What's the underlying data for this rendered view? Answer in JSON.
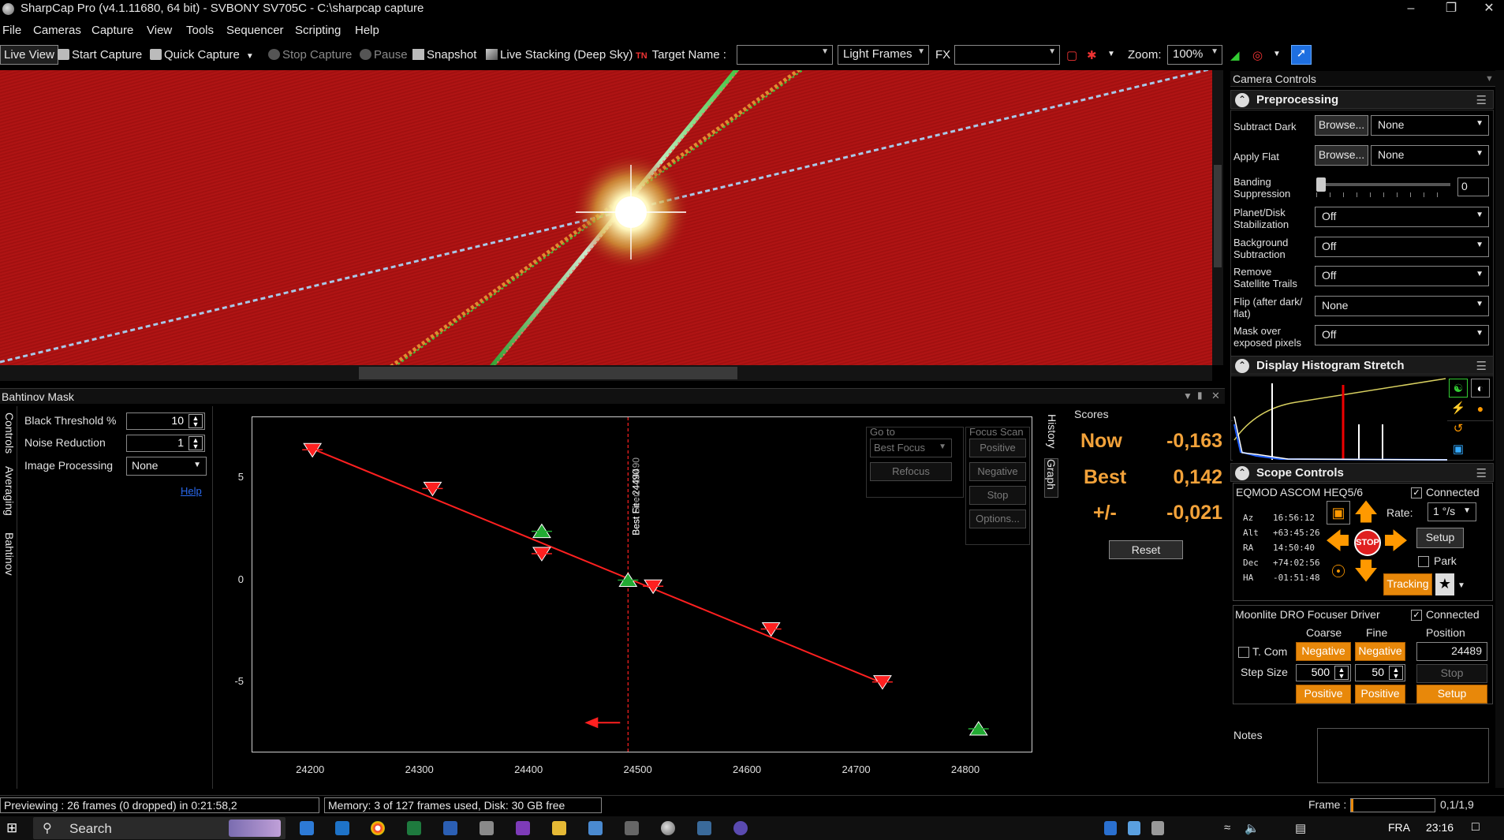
{
  "window": {
    "title": "SharpCap Pro (v4.1.11680, 64 bit) - SVBONY SV705C - C:\\sharpcap capture"
  },
  "menu": [
    "File",
    "Cameras",
    "Capture",
    "View",
    "Tools",
    "Sequencer",
    "Scripting",
    "Help"
  ],
  "toolbar": {
    "live_view": "Live View",
    "start_capture": "Start Capture",
    "quick_capture": "Quick Capture",
    "stop_capture": "Stop Capture",
    "pause": "Pause",
    "snapshot": "Snapshot",
    "live_stacking": "Live Stacking (Deep Sky)",
    "target_name_label": "Target Name :",
    "target_name_value": "",
    "frame_type": "Light Frames",
    "fx_label": "FX",
    "fx_value": "",
    "zoom_label": "Zoom:",
    "zoom_value": "100%"
  },
  "camera_controls": {
    "header": "Camera Controls",
    "preprocessing": {
      "title": "Preprocessing",
      "subtract_dark_label": "Subtract Dark",
      "browse": "Browse...",
      "subtract_dark_value": "None",
      "apply_flat_label": "Apply Flat",
      "apply_flat_value": "None",
      "banding_label": "Banding Suppression",
      "banding_value": "0",
      "banding_level": 0,
      "planet_label": "Planet/Disk Stabilization",
      "planet_value": "Off",
      "background_label": "Background Subtraction",
      "background_value": "Off",
      "satellite_label": "Remove Satellite Trails",
      "satellite_value": "Off",
      "flip_label": "Flip (after dark/ flat)",
      "flip_value": "None",
      "mask_label": "Mask over exposed pixels",
      "mask_value": "Off"
    },
    "histogram": {
      "title": "Display Histogram Stretch"
    },
    "scope": {
      "title": "Scope Controls",
      "mount_name": "EQMOD ASCOM HEQ5/6",
      "connected_label": "Connected",
      "coords": [
        {
          "k": "Az",
          "v": "16:56:12"
        },
        {
          "k": "Alt",
          "v": "+63:45:26"
        },
        {
          "k": "RA",
          "v": "14:50:40"
        },
        {
          "k": "Dec",
          "v": "+74:02:56"
        },
        {
          "k": "HA",
          "v": "-01:51:48"
        }
      ],
      "rate_label": "Rate:",
      "rate_value": "1 °/s",
      "setup": "Setup",
      "park": "Park",
      "stop": "STOP",
      "tracking": "Tracking"
    },
    "focuser": {
      "name": "Moonlite DRO Focuser Driver",
      "connected_label": "Connected",
      "coarse": "Coarse",
      "fine": "Fine",
      "position_label": "Position",
      "tcom": "T. Com",
      "negative": "Negative",
      "positive": "Positive",
      "position_value": "24489",
      "step_size_label": "Step Size",
      "coarse_step": "500",
      "fine_step": "50",
      "stop": "Stop",
      "setup": "Setup"
    },
    "notes_label": "Notes"
  },
  "bahtinov": {
    "title": "Bahtinov Mask",
    "tabs": [
      "Controls",
      "Averaging",
      "Bahtinov"
    ],
    "black_threshold_label": "Black Threshold %",
    "black_threshold_value": "10",
    "noise_reduction_label": "Noise Reduction",
    "noise_reduction_value": "1",
    "image_processing_label": "Image Processing",
    "image_processing_value": "None",
    "help": "Help",
    "goto_label": "Go to",
    "best_focus": "Best Focus",
    "refocus": "Refocus",
    "focus_scan_label": "Focus Scan",
    "positive": "Positive",
    "negative": "Negative",
    "stop": "Stop",
    "options": "Options...",
    "right_tabs": [
      "History",
      "Graph"
    ],
    "best_fit_label": "Best Fit : 24490",
    "best_seen_label": "Best Seen : 24490"
  },
  "chart_data": {
    "type": "scatter",
    "xlim": [
      24145,
      24860
    ],
    "ylim": [
      -8.5,
      8.0
    ],
    "xticks": [
      24200,
      24300,
      24400,
      24500,
      24600,
      24700,
      24800
    ],
    "yticks": [
      5,
      0,
      -5
    ],
    "series": [
      {
        "marker": "down-triangle",
        "color": "#ff2020",
        "points": [
          [
            24200,
            6.4
          ],
          [
            24310,
            4.5
          ],
          [
            24410,
            1.3
          ],
          [
            24512,
            -0.3
          ],
          [
            24620,
            -2.4
          ],
          [
            24722,
            -5.0
          ]
        ]
      },
      {
        "marker": "up-triangle",
        "color": "#22aa33",
        "points": [
          [
            24410,
            2.4
          ],
          [
            24489,
            0.0
          ],
          [
            24810,
            -7.3
          ]
        ]
      }
    ],
    "fit_line": [
      [
        24200,
        6.45
      ],
      [
        24722,
        -5.05
      ]
    ],
    "best_focus_x": 24489
  },
  "scores": {
    "title": "Scores",
    "now_label": "Now",
    "now_value": "-0,163",
    "best_label": "Best",
    "best_value": "0,142",
    "pm_label": "+/-",
    "pm_value": "-0,021",
    "reset": "Reset"
  },
  "status": {
    "preview": "Previewing : 26 frames (0 dropped) in 0:21:58,2",
    "memory": "Memory: 3 of 127 frames used, Disk: 30 GB free",
    "frame_label": "Frame :",
    "frame_value": "0,1/1,9"
  },
  "taskbar": {
    "search": "Search",
    "lang": "FRA",
    "time": "23:16"
  },
  "colors": {
    "accent_orange": "#e8880a",
    "red": "#e00000",
    "green": "#22aa33"
  }
}
